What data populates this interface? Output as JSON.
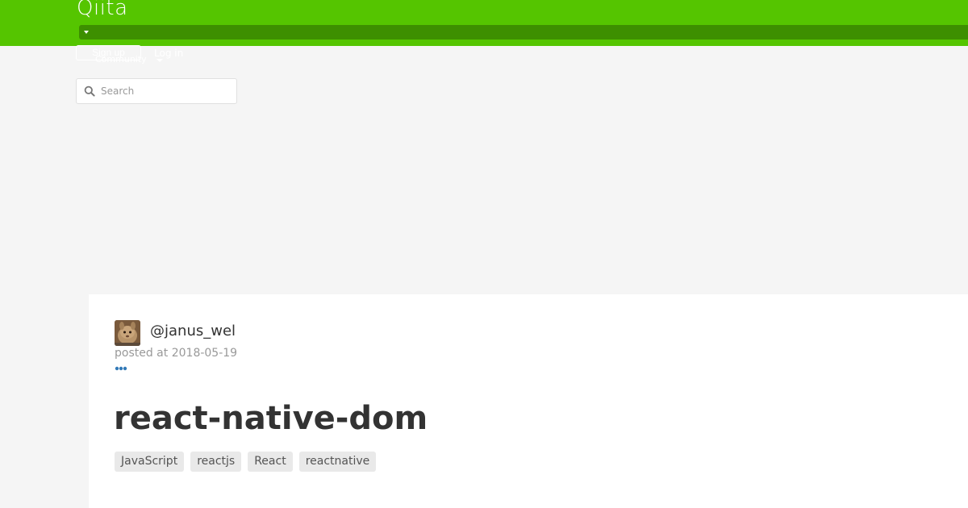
{
  "header": {
    "logo_text": "Qiita",
    "brand_color": "#55c500",
    "community_bar_color": "#3d8f00"
  },
  "auth": {
    "signup_label": "Sign up",
    "login_label": "Log in"
  },
  "community": {
    "label": "Community"
  },
  "search": {
    "placeholder": "Search",
    "value": ""
  },
  "article": {
    "author": "@janus_wel",
    "posted_prefix": "posted at",
    "posted_date": "2018-05-19",
    "title": "react-native-dom",
    "tags": [
      "JavaScript",
      "reactjs",
      "React",
      "reactnative"
    ],
    "accent_color": "#337ab7"
  },
  "icons": {
    "search": "search-icon",
    "caret": "caret-down-icon",
    "avatar": "avatar",
    "more": "ellipsis-icon"
  }
}
